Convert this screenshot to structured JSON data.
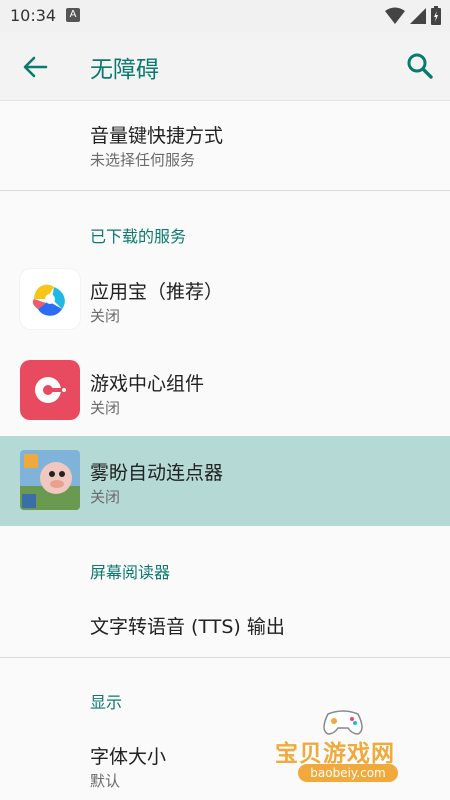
{
  "status_bar": {
    "time": "10:34",
    "notification_icon": "A"
  },
  "app_bar": {
    "title": "无障碍"
  },
  "volume_shortcut": {
    "title": "音量键快捷方式",
    "subtitle": "未选择任何服务"
  },
  "downloaded_services": {
    "header": "已下载的服务",
    "items": [
      {
        "title": "应用宝（推荐）",
        "subtitle": "关闭",
        "icon": "app-store-icon"
      },
      {
        "title": "游戏中心组件",
        "subtitle": "关闭",
        "icon": "game-center-icon"
      },
      {
        "title": "雾盼自动连点器",
        "subtitle": "关闭",
        "icon": "auto-clicker-icon"
      }
    ]
  },
  "screen_reader": {
    "header": "屏幕阅读器",
    "tts_title": "文字转语音 (TTS) 输出"
  },
  "display": {
    "header": "显示",
    "font_size_title": "字体大小",
    "font_size_value": "默认"
  },
  "watermark": {
    "brand": "宝贝游戏网",
    "url": "baobeiy.com"
  },
  "colors": {
    "accent": "#0b7a6e",
    "highlight": "#b5dad6",
    "game_center": "#e84a5f"
  }
}
